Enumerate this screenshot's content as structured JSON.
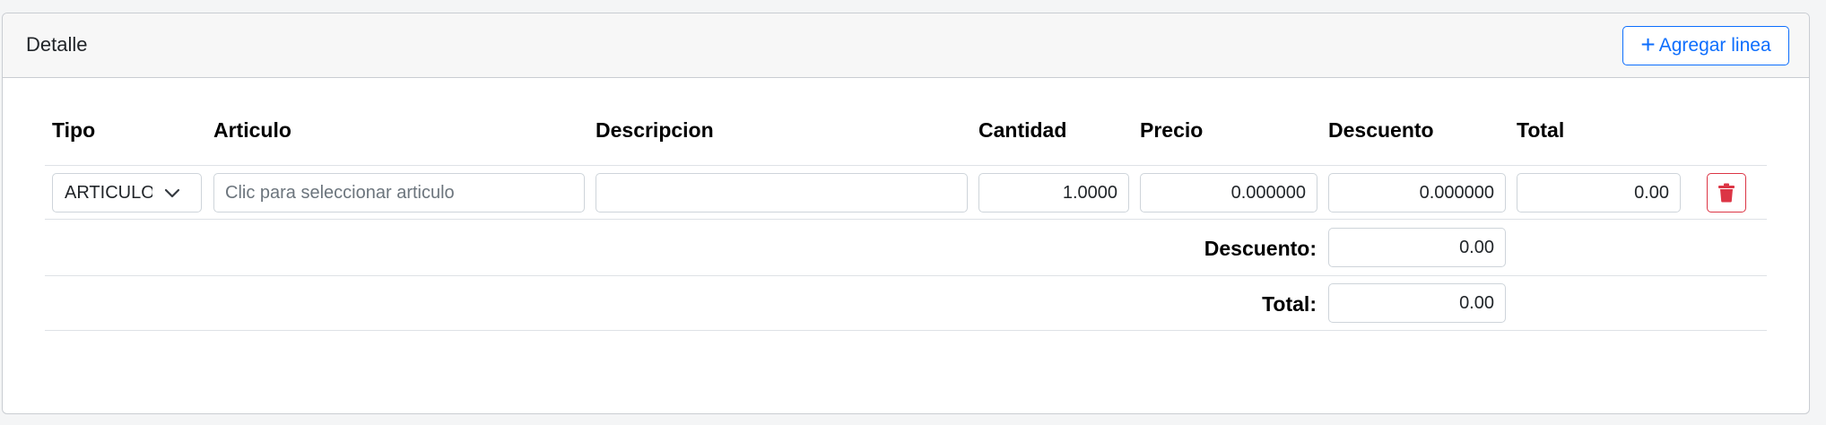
{
  "card": {
    "title": "Detalle",
    "add_button_label": "Agregar linea"
  },
  "table": {
    "columns": [
      "Tipo",
      "Articulo",
      "Descripcion",
      "Cantidad",
      "Precio",
      "Descuento",
      "Total"
    ],
    "row": {
      "tipo": "ARTICULO",
      "articulo_placeholder": "Clic para seleccionar articulo",
      "descripcion": "",
      "cantidad": "1.0000",
      "precio": "0.000000",
      "descuento": "0.000000",
      "total": "0.00"
    }
  },
  "summary": {
    "descuento_label": "Descuento:",
    "descuento_value": "0.00",
    "total_label": "Total:",
    "total_value": "0.00"
  },
  "colors": {
    "primary": "#0d6efd",
    "danger": "#dc3545",
    "border": "#ced4da"
  },
  "icons": {
    "add": "plus-icon",
    "select": "chevron-down-icon",
    "delete": "trash-icon"
  }
}
